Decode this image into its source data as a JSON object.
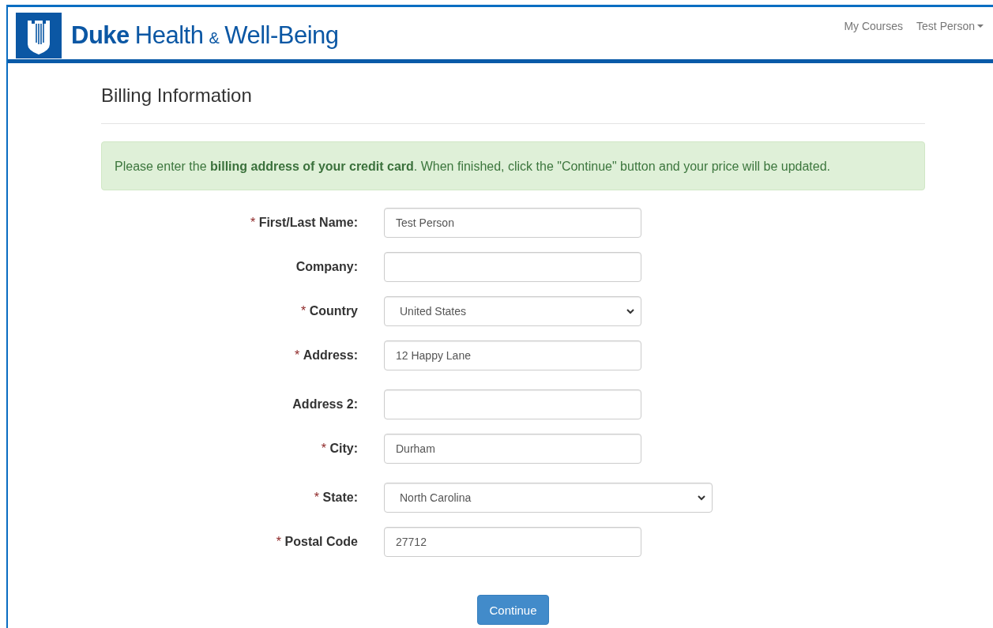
{
  "header": {
    "brand_bold": "Duke",
    "brand_rest": "Health",
    "brand_amp": "&",
    "brand_tail": "Well-Being",
    "nav": [
      {
        "label": "My Courses",
        "kind": "link"
      },
      {
        "label": "Test Person",
        "kind": "dropdown"
      }
    ]
  },
  "page_title": "Billing Information",
  "alert": "Please enter the **billing address of your credit card**. When finished, click the \"Continue\" button and your price will be updated.",
  "fields": [
    {
      "label": "First/Last Name:",
      "required_mark": "*",
      "kind": "input",
      "value": "Test Person"
    },
    {
      "label": "Company:",
      "kind": "input"
    },
    {
      "label": "Country",
      "required_mark": "*",
      "kind": "select",
      "value": "United States"
    },
    {
      "label": "Address:",
      "required_mark": "*",
      "kind": "input",
      "value": "12 Happy Lane"
    },
    {
      "label": "Address 2:",
      "kind": "input"
    },
    {
      "label": "City:",
      "required_mark": "*",
      "kind": "input",
      "value": "Durham"
    },
    {
      "label": "State:",
      "required_mark": "*",
      "kind": "wideselect",
      "value": "North Carolina"
    },
    {
      "label": "Postal Code",
      "required_mark": "*",
      "kind": "input",
      "value": "27712"
    }
  ],
  "button": "Continue"
}
